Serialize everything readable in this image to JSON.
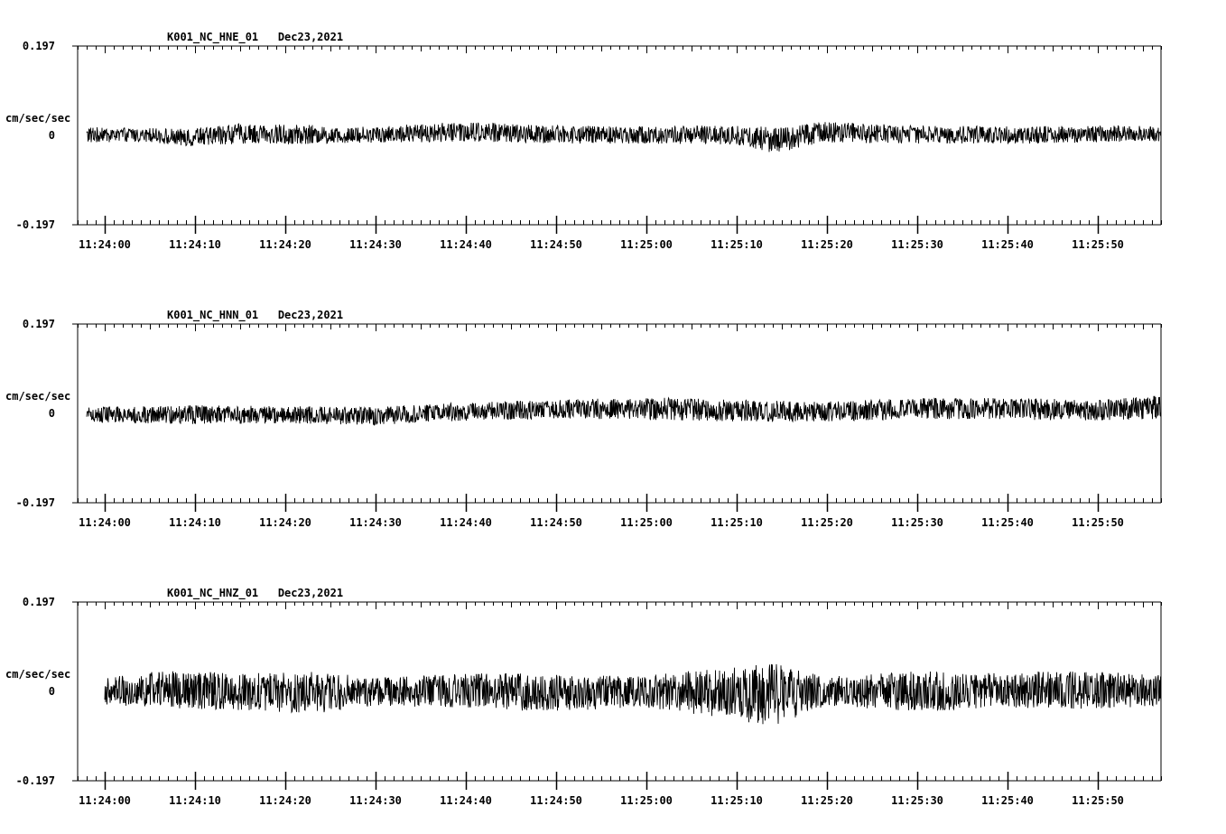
{
  "chart_data": [
    {
      "type": "line",
      "title": "K001_NC_HNE_01   Dec23,2021",
      "ylabel": "cm/sec/sec",
      "ylim": [
        -0.197,
        0.197
      ],
      "yticks": [
        "0.197",
        "0",
        "-0.197"
      ],
      "xlim": [
        "11:23:57",
        "11:25:57"
      ],
      "xticks": [
        "11:24:00",
        "11:24:10",
        "11:24:20",
        "11:24:30",
        "11:24:40",
        "11:24:50",
        "11:25:00",
        "11:25:10",
        "11:25:20",
        "11:25:30",
        "11:25:40",
        "11:25:50"
      ],
      "series": [
        {
          "x_start": "11:23:58",
          "x_end": "11:25:57",
          "envelope": [
            [
              "11:24:00",
              -0.016,
              0.018
            ],
            [
              "11:24:05",
              -0.014,
              0.016
            ],
            [
              "11:24:09",
              -0.026,
              0.014
            ],
            [
              "11:24:15",
              -0.018,
              0.026
            ],
            [
              "11:24:20",
              -0.02,
              0.024
            ],
            [
              "11:24:30",
              -0.016,
              0.02
            ],
            [
              "11:24:40",
              -0.014,
              0.03
            ],
            [
              "11:24:50",
              -0.018,
              0.022
            ],
            [
              "11:25:00",
              -0.018,
              0.02
            ],
            [
              "11:25:10",
              -0.02,
              0.022
            ],
            [
              "11:25:14",
              -0.04,
              0.018
            ],
            [
              "11:25:20",
              -0.016,
              0.03
            ],
            [
              "11:25:30",
              -0.018,
              0.022
            ],
            [
              "11:25:40",
              -0.018,
              0.02
            ],
            [
              "11:25:50",
              -0.018,
              0.022
            ],
            [
              "11:25:57",
              -0.014,
              0.02
            ]
          ]
        }
      ]
    },
    {
      "type": "line",
      "title": "K001_NC_HNN_01   Dec23,2021",
      "ylabel": "cm/sec/sec",
      "ylim": [
        -0.197,
        0.197
      ],
      "yticks": [
        "0.197",
        "0",
        "-0.197"
      ],
      "xlim": [
        "11:23:57",
        "11:25:57"
      ],
      "xticks": [
        "11:24:00",
        "11:24:10",
        "11:24:20",
        "11:24:30",
        "11:24:40",
        "11:24:50",
        "11:25:00",
        "11:25:10",
        "11:25:20",
        "11:25:30",
        "11:25:40",
        "11:25:50"
      ],
      "series": [
        {
          "x_start": "11:23:58",
          "x_end": "11:25:57",
          "envelope": [
            [
              "11:24:00",
              -0.02,
              0.014
            ],
            [
              "11:24:10",
              -0.024,
              0.018
            ],
            [
              "11:24:20",
              -0.022,
              0.016
            ],
            [
              "11:24:30",
              -0.026,
              0.014
            ],
            [
              "11:24:35",
              -0.02,
              0.02
            ],
            [
              "11:24:40",
              -0.016,
              0.024
            ],
            [
              "11:24:50",
              -0.012,
              0.03
            ],
            [
              "11:25:00",
              -0.014,
              0.036
            ],
            [
              "11:25:10",
              -0.018,
              0.03
            ],
            [
              "11:25:20",
              -0.018,
              0.026
            ],
            [
              "11:25:30",
              -0.012,
              0.034
            ],
            [
              "11:25:40",
              -0.014,
              0.034
            ],
            [
              "11:25:50",
              -0.016,
              0.03
            ],
            [
              "11:25:57",
              -0.012,
              0.04
            ]
          ]
        }
      ]
    },
    {
      "type": "line",
      "title": "K001_NC_HNZ_01   Dec23,2021",
      "ylabel": "cm/sec/sec",
      "ylim": [
        -0.197,
        0.197
      ],
      "yticks": [
        "0.197",
        "0",
        "-0.197"
      ],
      "xlim": [
        "11:23:57",
        "11:25:57"
      ],
      "xticks": [
        "11:24:00",
        "11:24:10",
        "11:24:20",
        "11:24:30",
        "11:24:40",
        "11:24:50",
        "11:25:00",
        "11:25:10",
        "11:25:20",
        "11:25:30",
        "11:25:40",
        "11:25:50"
      ],
      "series": [
        {
          "x_start": "11:24:00",
          "x_end": "11:25:57",
          "envelope": [
            [
              "11:24:00",
              -0.03,
              0.03
            ],
            [
              "11:24:06",
              -0.036,
              0.046
            ],
            [
              "11:24:18",
              -0.044,
              0.04
            ],
            [
              "11:24:23",
              -0.05,
              0.046
            ],
            [
              "11:24:30",
              -0.032,
              0.03
            ],
            [
              "11:24:40",
              -0.036,
              0.04
            ],
            [
              "11:24:48",
              -0.044,
              0.04
            ],
            [
              "11:25:00",
              -0.036,
              0.036
            ],
            [
              "11:25:14",
              -0.076,
              0.062
            ],
            [
              "11:25:20",
              -0.032,
              0.032
            ],
            [
              "11:25:30",
              -0.044,
              0.046
            ],
            [
              "11:25:40",
              -0.036,
              0.04
            ],
            [
              "11:25:47",
              -0.04,
              0.048
            ],
            [
              "11:25:57",
              -0.034,
              0.036
            ]
          ]
        }
      ]
    }
  ]
}
